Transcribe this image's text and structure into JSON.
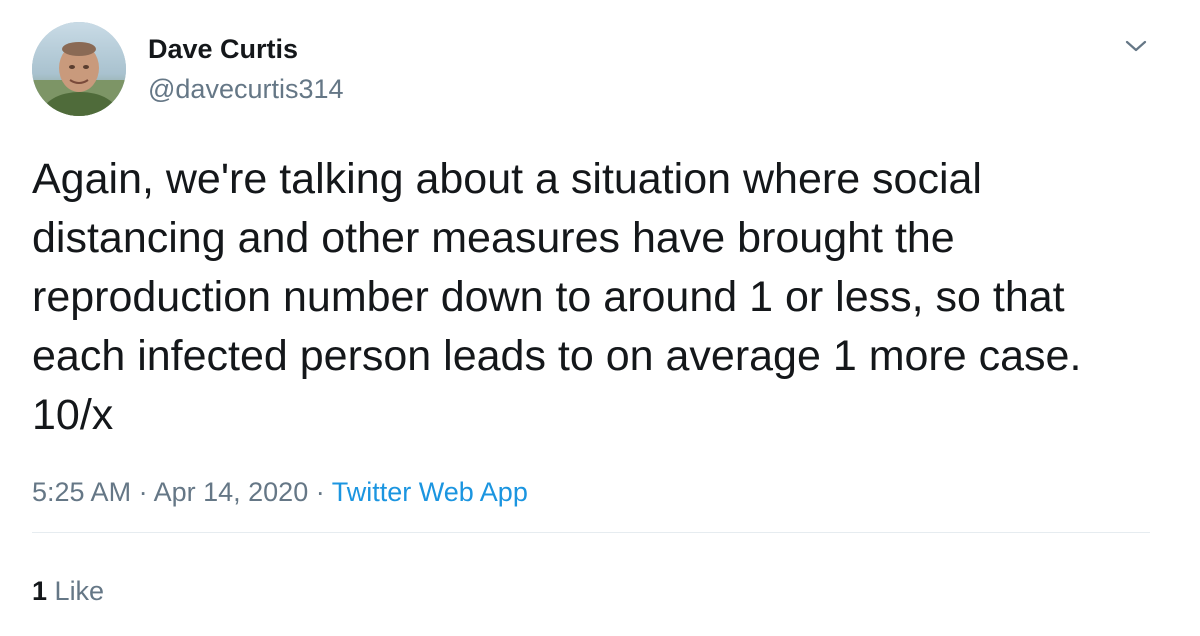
{
  "author": {
    "name": "Dave Curtis",
    "handle": "@davecurtis314",
    "avatar_icon": "profile-photo"
  },
  "menu_icon": "chevron-down-icon",
  "tweet": {
    "text": "Again, we're talking about a situation where social\ndistancing and other measures have brought the\nreproduction number down to around 1 or less, so that\neach infected person leads to on average 1 more case.\n10/x",
    "time": "5:25 AM",
    "separator": "·",
    "date": "Apr 14, 2020",
    "source": "Twitter Web App"
  },
  "engagement": {
    "likes_count": "1",
    "likes_label": "Like"
  },
  "colors": {
    "text_primary": "#14171a",
    "text_secondary": "#657786",
    "link": "#1b95e0",
    "divider": "#e6ecf0"
  }
}
